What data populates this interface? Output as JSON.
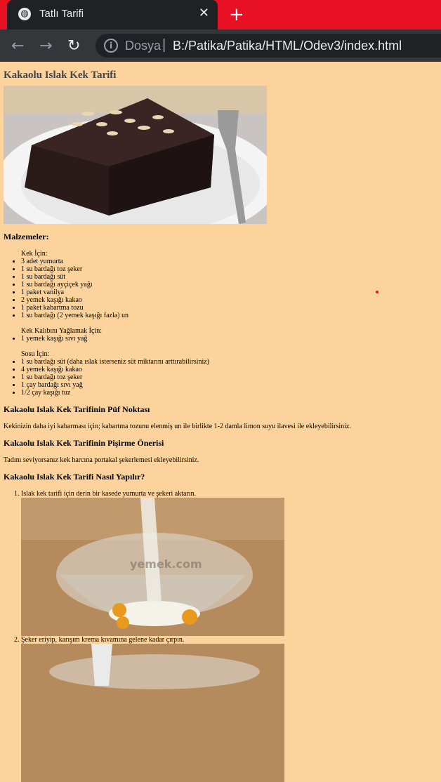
{
  "tab": {
    "title": "Tatlı Tarifi"
  },
  "address": {
    "scheme": "Dosya",
    "url": "B:/Patika/Patika/HTML/Odev3/index.html"
  },
  "page": {
    "title": "Kakaolu Islak Kek Tarifi",
    "ingredients_heading": "Malzemeler:",
    "cake_label": "Kek İçin:",
    "cake_items": [
      "3 adet yumurta",
      "1 su bardağı toz şeker",
      "1 su bardağı süt",
      "1 su bardağı ayçiçek yağı",
      "1 paket vanilya",
      "2 yemek kaşığı kakao",
      "1 paket kabartma tozu",
      "1 su bardağı (2 yemek kaşığı fazla) un"
    ],
    "mold_label": "Kek Kalıbını Yağlamak İçin:",
    "mold_items": [
      "1 yemek kaşığı sıvı yağ"
    ],
    "sauce_label": "Sosu İçin:",
    "sauce_items": [
      "1 su bardağı süt (daha ıslak isterseniz süt miktarını arttırabilirsiniz)",
      "4 yemek kaşığı kakao",
      "1 su bardağı toz şeker",
      "1 çay bardağı sıvı yağ",
      "1/2 çay kaşığı tuz"
    ],
    "tip_heading": "Kakaolu Islak Kek Tarifinin Püf Noktası",
    "tip_text": "Kekinizin daha iyi kabarması için; kabartma tozunu elenmiş un ile birlikte 1-2 damla limon suyu ilavesi ile ekleyebilirsiniz.",
    "suggest_heading": "Kakaolu Islak Kek Tarifinin Pişirme Önerisi",
    "suggest_text": "Tadını seviyorsanız kek harcına portakal şekerlemesi ekleyebilirsiniz.",
    "howto_heading": "Kakaolu Islak Kek Tarifi Nasıl Yapılır?",
    "steps": [
      "Islak kek tarifi için derin bir kasede yumurta ve şekeri aktarın.",
      "Şeker eriyip, karışım krema kıvamına gelene kadar çırpın."
    ],
    "watermark": "yemek.com"
  }
}
